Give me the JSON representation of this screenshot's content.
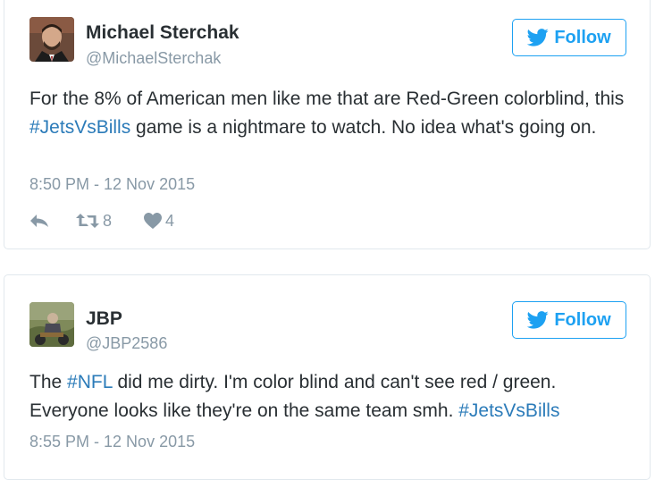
{
  "tweets": [
    {
      "name": "Michael Sterchak",
      "handle": "@MichaelSterchak",
      "follow_label": "Follow",
      "text_parts": [
        "For the 8% of American men like me that are Red-Green colorblind, this ",
        "#JetsVsBills",
        " game is a nightmare to watch. No idea what's going on."
      ],
      "timestamp": "8:50 PM - 12 Nov 2015",
      "retweets": "8",
      "likes": "4",
      "icons": [
        "reply-icon",
        "retweet-icon",
        "heart-icon"
      ]
    },
    {
      "name": "JBP",
      "handle": "@JBP2586",
      "follow_label": "Follow",
      "text_parts": [
        "The ",
        "#NFL",
        " did me dirty. I'm color blind and can't see red / green. Everyone looks like they're on the same team smh. ",
        "#JetsVsBills"
      ],
      "timestamp": "8:55 PM - 12 Nov 2015"
    }
  ],
  "colors": {
    "accent": "#1da1f2",
    "hashtag": "#2b7bb9",
    "muted": "#8899a6",
    "text": "#292f33",
    "border": "#e1e8ed"
  }
}
